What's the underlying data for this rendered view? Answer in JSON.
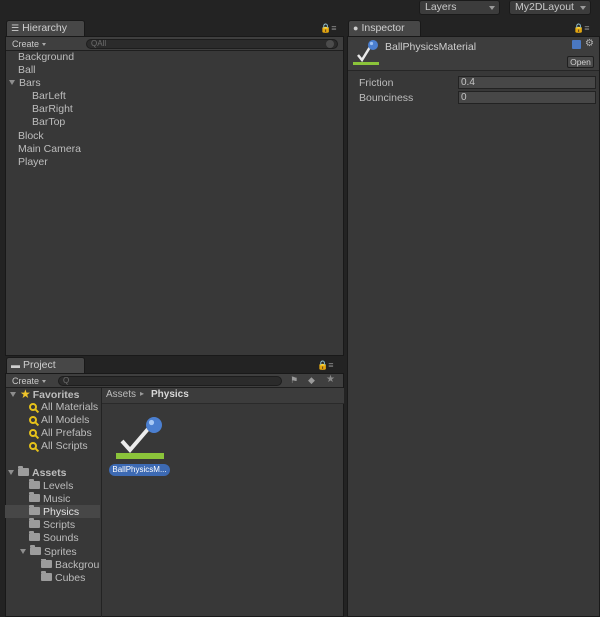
{
  "topbar": {
    "layers_label": "Layers",
    "layout_label": "My2DLayout"
  },
  "hierarchy": {
    "tab_label": "Hierarchy",
    "create_label": "Create",
    "search_placeholder": "All",
    "items": [
      {
        "label": "Background"
      },
      {
        "label": "Ball"
      },
      {
        "label": "Bars"
      },
      {
        "label": "BarLeft"
      },
      {
        "label": "BarRight"
      },
      {
        "label": "BarTop"
      },
      {
        "label": "Block"
      },
      {
        "label": "Main Camera"
      },
      {
        "label": "Player"
      }
    ]
  },
  "inspector": {
    "tab_label": "Inspector",
    "asset_name": "BallPhysicsMaterial",
    "open_label": "Open",
    "fields": [
      {
        "label": "Friction",
        "value": "0.4"
      },
      {
        "label": "Bounciness",
        "value": "0"
      }
    ]
  },
  "project": {
    "tab_label": "Project",
    "create_label": "Create",
    "favorites_label": "Favorites",
    "favorites": [
      {
        "label": "All Materials"
      },
      {
        "label": "All Models"
      },
      {
        "label": "All Prefabs"
      },
      {
        "label": "All Scripts"
      }
    ],
    "assets_label": "Assets",
    "folders": [
      {
        "label": "Levels"
      },
      {
        "label": "Music"
      },
      {
        "label": "Physics"
      },
      {
        "label": "Scripts"
      },
      {
        "label": "Sounds"
      },
      {
        "label": "Sprites"
      },
      {
        "label": "Backgrour"
      },
      {
        "label": "Cubes"
      }
    ],
    "breadcrumb_root": "Assets",
    "breadcrumb_current": "Physics",
    "asset_tile_label": "BallPhysicsM..."
  },
  "colors": {
    "panel_bg": "#383838",
    "selection": "#3d6ab3",
    "favorite_star": "#f0c52a"
  }
}
